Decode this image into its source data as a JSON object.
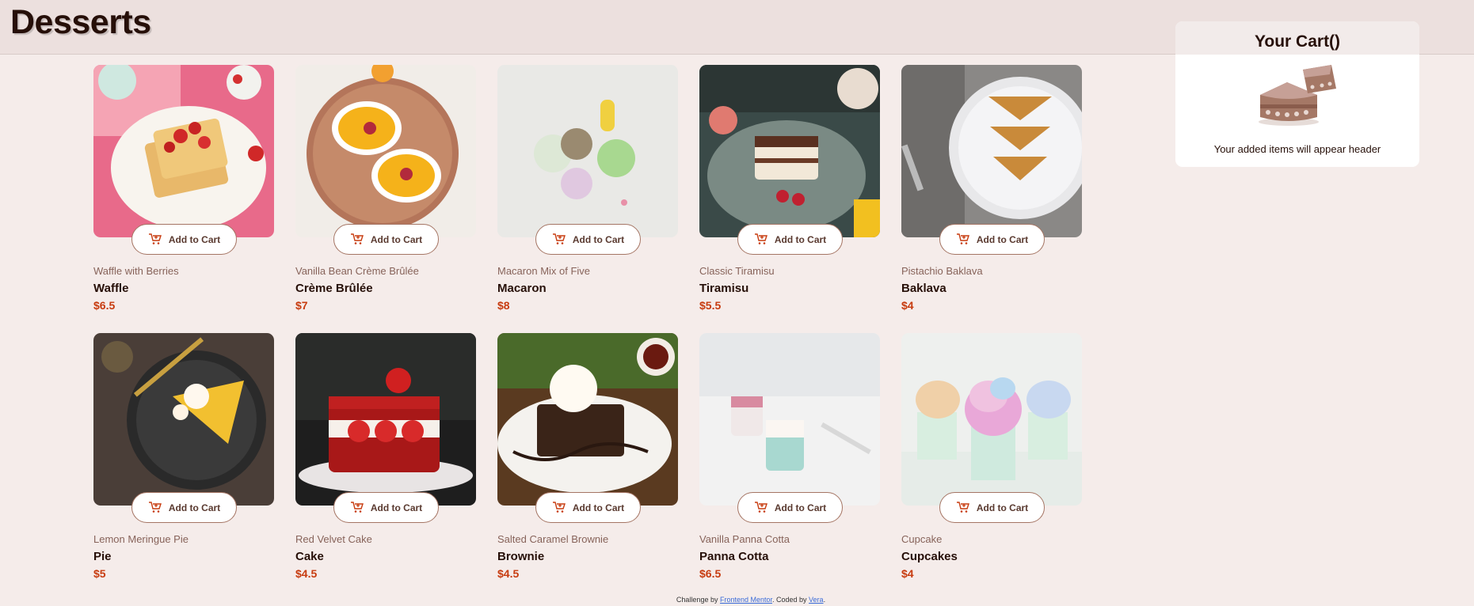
{
  "page": {
    "title": "Desserts"
  },
  "add_to_cart_label": "Add to Cart",
  "products": [
    {
      "category": "Waffle with Berries",
      "name": "Waffle",
      "price": "$6.5",
      "image": "waffle"
    },
    {
      "category": "Vanilla Bean Crème Brûlée",
      "name": "Crème Brûlée",
      "price": "$7",
      "image": "creme-brulee"
    },
    {
      "category": "Macaron Mix of Five",
      "name": "Macaron",
      "price": "$8",
      "image": "macaron"
    },
    {
      "category": "Classic Tiramisu",
      "name": "Tiramisu",
      "price": "$5.5",
      "image": "tiramisu"
    },
    {
      "category": "Pistachio Baklava",
      "name": "Baklava",
      "price": "$4",
      "image": "baklava"
    },
    {
      "category": "Lemon Meringue Pie",
      "name": "Pie",
      "price": "$5",
      "image": "pie"
    },
    {
      "category": "Red Velvet Cake",
      "name": "Cake",
      "price": "$4.5",
      "image": "cake"
    },
    {
      "category": "Salted Caramel Brownie",
      "name": "Brownie",
      "price": "$4.5",
      "image": "brownie"
    },
    {
      "category": "Vanilla Panna Cotta",
      "name": "Panna Cotta",
      "price": "$6.5",
      "image": "panna-cotta"
    },
    {
      "category": "Cupcake",
      "name": "Cupcakes",
      "price": "$4",
      "image": "cupcake"
    }
  ],
  "cart": {
    "title": "Your Cart()",
    "empty_text": "Your added items will appear header"
  },
  "footer": {
    "prefix": "Challenge by ",
    "link1": "Frontend Mentor",
    "middle": ". Coded by ",
    "link2": "Vera",
    "suffix": "."
  },
  "colors": {
    "accent": "#c73b0f",
    "background": "#f5ecea",
    "text": "#260f08"
  }
}
